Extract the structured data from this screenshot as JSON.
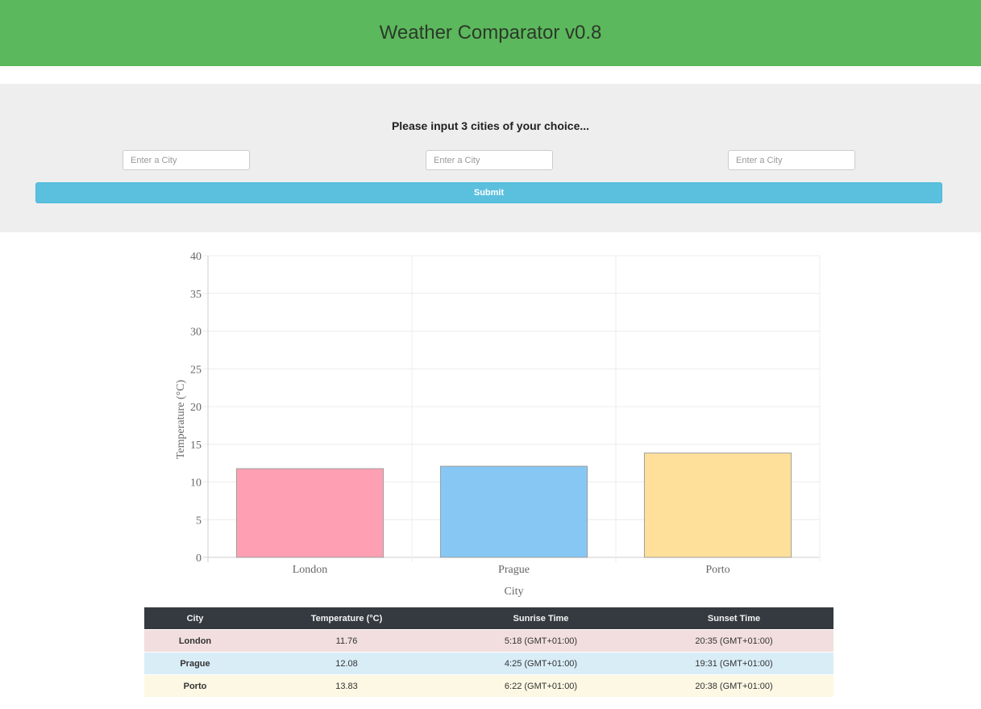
{
  "header": {
    "title": "Weather Comparator v0.8"
  },
  "form": {
    "prompt": "Please input 3 cities of your choice...",
    "inputs": [
      {
        "placeholder": "Enter a City",
        "value": ""
      },
      {
        "placeholder": "Enter a City",
        "value": ""
      },
      {
        "placeholder": "Enter a City",
        "value": ""
      }
    ],
    "submit_label": "Submit"
  },
  "chart_data": {
    "type": "bar",
    "categories": [
      "London",
      "Prague",
      "Porto"
    ],
    "values": [
      11.76,
      12.08,
      13.83
    ],
    "colors": [
      "#ff9fb3",
      "#87c7f3",
      "#ffe09a"
    ],
    "xlabel": "City",
    "ylabel": "Temperature (°C)",
    "ylim": [
      0,
      40
    ],
    "yticks": [
      "0",
      "5",
      "10",
      "15",
      "20",
      "25",
      "30",
      "35",
      "40"
    ],
    "grid": true
  },
  "table": {
    "headers": [
      "City",
      "Temperature (°C)",
      "Sunrise Time",
      "Sunset Time"
    ],
    "rows": [
      {
        "city": "London",
        "temperature": "11.76",
        "sunrise": "5:18 (GMT+01:00)",
        "sunset": "20:35 (GMT+01:00)",
        "color": "#f2dede"
      },
      {
        "city": "Prague",
        "temperature": "12.08",
        "sunrise": "4:25 (GMT+01:00)",
        "sunset": "19:31 (GMT+01:00)",
        "color": "#d9edf7"
      },
      {
        "city": "Porto",
        "temperature": "13.83",
        "sunrise": "6:22 (GMT+01:00)",
        "sunset": "20:38 (GMT+01:00)",
        "color": "#fcf8e3"
      }
    ]
  }
}
